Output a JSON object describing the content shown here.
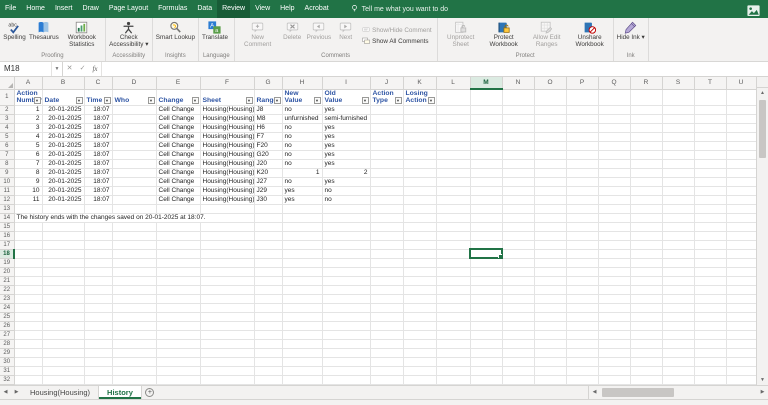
{
  "theme": {
    "titlebar_green": "#217346",
    "active_tab_green": "#185c37",
    "selection_green": "#217346",
    "header_text_blue": "#2f55a4",
    "disabled_gray": "#a19f9d"
  },
  "titlebar": {
    "tabs": [
      "File",
      "Home",
      "Insert",
      "Draw",
      "Page Layout",
      "Formulas",
      "Data",
      "Review",
      "View",
      "Help",
      "Acrobat"
    ],
    "active_tab": "Review",
    "tell_me": "Tell me what you want to do"
  },
  "ribbon": {
    "groups": [
      {
        "label": "Proofing",
        "buttons": [
          {
            "label": "Spelling",
            "icon": "spelling-icon"
          },
          {
            "label": "Thesaurus",
            "icon": "thesaurus-icon"
          },
          {
            "label": "Workbook Statistics",
            "icon": "workbook-statistics-icon"
          }
        ]
      },
      {
        "label": "Accessibility",
        "buttons": [
          {
            "label": "Check Accessibility",
            "icon": "check-accessibility-icon",
            "dropdown": true
          }
        ]
      },
      {
        "label": "Insights",
        "buttons": [
          {
            "label": "Smart Lookup",
            "icon": "smart-lookup-icon"
          }
        ]
      },
      {
        "label": "Language",
        "buttons": [
          {
            "label": "Translate",
            "icon": "translate-icon"
          }
        ]
      },
      {
        "label": "Comments",
        "buttons": [
          {
            "label": "New Comment",
            "icon": "new-comment-icon",
            "disabled": true
          },
          {
            "label": "Delete",
            "icon": "delete-comment-icon",
            "disabled": true
          },
          {
            "label": "Previous",
            "icon": "previous-comment-icon",
            "disabled": true
          },
          {
            "label": "Next",
            "icon": "next-comment-icon",
            "disabled": true
          }
        ],
        "toggles": [
          {
            "label": "Show/Hide Comment",
            "icon": "show-hide-comment-icon",
            "disabled": true
          },
          {
            "label": "Show All Comments",
            "icon": "show-all-comments-icon",
            "disabled": false
          }
        ]
      },
      {
        "label": "Protect",
        "buttons": [
          {
            "label": "Unprotect Sheet",
            "icon": "unprotect-sheet-icon",
            "disabled": true
          },
          {
            "label": "Protect Workbook",
            "icon": "protect-workbook-icon"
          },
          {
            "label": "Allow Edit Ranges",
            "icon": "allow-edit-ranges-icon",
            "disabled": true
          },
          {
            "label": "Unshare Workbook",
            "icon": "unshare-workbook-icon"
          }
        ]
      },
      {
        "label": "Ink",
        "buttons": [
          {
            "label": "Hide Ink",
            "icon": "hide-ink-icon",
            "dropdown": true
          }
        ]
      }
    ]
  },
  "formula_bar": {
    "name_box": "M18",
    "formula": ""
  },
  "sheet": {
    "columns": [
      "A",
      "B",
      "C",
      "D",
      "E",
      "F",
      "G",
      "H",
      "I",
      "J",
      "K",
      "L",
      "M",
      "N",
      "O",
      "P",
      "Q",
      "R",
      "S",
      "T",
      "U"
    ],
    "total_rows": 33,
    "selected_cell": {
      "column": "M",
      "row": 18
    },
    "header_row": [
      {
        "col": "A",
        "text": "Action\nNumber"
      },
      {
        "col": "B",
        "text": "Date"
      },
      {
        "col": "C",
        "text": "Time"
      },
      {
        "col": "D",
        "text": "Who"
      },
      {
        "col": "E",
        "text": "Change"
      },
      {
        "col": "F",
        "text": "Sheet"
      },
      {
        "col": "G",
        "text": "Range"
      },
      {
        "col": "H",
        "text": "New\nValue"
      },
      {
        "col": "I",
        "text": "Old\nValue"
      },
      {
        "col": "J",
        "text": "Action\nType"
      },
      {
        "col": "K",
        "text": "Losing\nAction"
      }
    ],
    "history_rows": [
      {
        "A": "1",
        "B": "20-01-2025",
        "C": "18:07",
        "D": "",
        "E": "Cell Change",
        "F": "Housing(Housing)",
        "G": "J8",
        "H": "no",
        "I": "yes",
        "J": "",
        "K": ""
      },
      {
        "A": "2",
        "B": "20-01-2025",
        "C": "18:07",
        "D": "",
        "E": "Cell Change",
        "F": "Housing(Housing)",
        "G": "M8",
        "H": "unfurnished",
        "I": "semi-furnished",
        "J": "",
        "K": ""
      },
      {
        "A": "3",
        "B": "20-01-2025",
        "C": "18:07",
        "D": "",
        "E": "Cell Change",
        "F": "Housing(Housing)",
        "G": "H6",
        "H": "no",
        "I": "yes",
        "J": "",
        "K": ""
      },
      {
        "A": "4",
        "B": "20-01-2025",
        "C": "18:07",
        "D": "",
        "E": "Cell Change",
        "F": "Housing(Housing)",
        "G": "F7",
        "H": "no",
        "I": "yes",
        "J": "",
        "K": ""
      },
      {
        "A": "5",
        "B": "20-01-2025",
        "C": "18:07",
        "D": "",
        "E": "Cell Change",
        "F": "Housing(Housing)",
        "G": "F20",
        "H": "no",
        "I": "yes",
        "J": "",
        "K": ""
      },
      {
        "A": "6",
        "B": "20-01-2025",
        "C": "18:07",
        "D": "",
        "E": "Cell Change",
        "F": "Housing(Housing)",
        "G": "G20",
        "H": "no",
        "I": "yes",
        "J": "",
        "K": ""
      },
      {
        "A": "7",
        "B": "20-01-2025",
        "C": "18:07",
        "D": "",
        "E": "Cell Change",
        "F": "Housing(Housing)",
        "G": "J20",
        "H": "no",
        "I": "yes",
        "J": "",
        "K": ""
      },
      {
        "A": "8",
        "B": "20-01-2025",
        "C": "18:07",
        "D": "",
        "E": "Cell Change",
        "F": "Housing(Housing)",
        "G": "K20",
        "H": "1",
        "I": "2",
        "J": "",
        "K": ""
      },
      {
        "A": "9",
        "B": "20-01-2025",
        "C": "18:07",
        "D": "",
        "E": "Cell Change",
        "F": "Housing(Housing)",
        "G": "J27",
        "H": "no",
        "I": "yes",
        "J": "",
        "K": ""
      },
      {
        "A": "10",
        "B": "20-01-2025",
        "C": "18:07",
        "D": "",
        "E": "Cell Change",
        "F": "Housing(Housing)",
        "G": "J29",
        "H": "yes",
        "I": "no",
        "J": "",
        "K": ""
      },
      {
        "A": "11",
        "B": "20-01-2025",
        "C": "18:07",
        "D": "",
        "E": "Cell Change",
        "F": "Housing(Housing)",
        "G": "J30",
        "H": "yes",
        "I": "no",
        "J": "",
        "K": ""
      }
    ],
    "note": {
      "row": 14,
      "text": "The history ends with the changes saved on 20-01-2025 at 18:07."
    }
  },
  "tab_bar": {
    "sheets": [
      {
        "label": "Housing(Housing)",
        "active": false
      },
      {
        "label": "History",
        "active": true
      }
    ]
  }
}
